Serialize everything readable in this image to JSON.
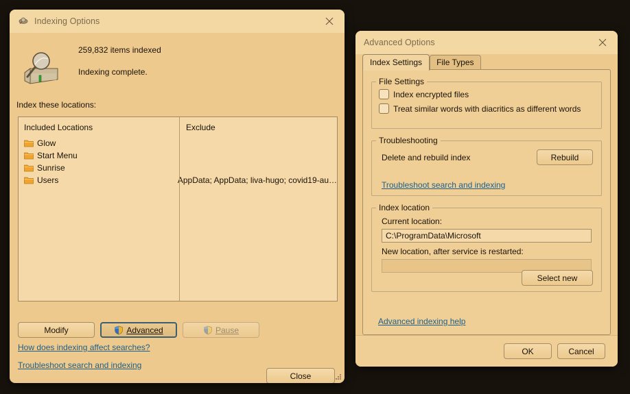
{
  "theme": {
    "desktop_bg": "#17120c",
    "window_bg": "#edc98e",
    "titlebar_bg": "#f4d8a4",
    "link_color": "#1c5f8a",
    "field_bg": "#f5d9a9",
    "border_color": "#a58e66"
  },
  "indexing_options": {
    "title": "Indexing Options",
    "title_icon": "indexing-options-icon",
    "close_icon": "close-icon",
    "status": {
      "icon": "hard-drive-search-icon",
      "count_text": "259,832 items indexed",
      "state_text": "Indexing complete."
    },
    "locations_label": "Index these locations:",
    "list": {
      "columns": [
        "Included Locations",
        "Exclude"
      ],
      "rows": [
        {
          "icon": "folder-icon",
          "name": "Glow",
          "exclude": ""
        },
        {
          "icon": "folder-icon",
          "name": "Start Menu",
          "exclude": ""
        },
        {
          "icon": "folder-icon",
          "name": "Sunrise",
          "exclude": ""
        },
        {
          "icon": "folder-icon",
          "name": "Users",
          "exclude": "AppData; AppData; liva-hugo; covid19-au…"
        }
      ]
    },
    "buttons": {
      "modify": "Modify",
      "modify_accesskey": "M",
      "advanced": "Advanced",
      "advanced_accesskey": "d",
      "advanced_icon": "uac-shield-icon",
      "advanced_focused": true,
      "pause": "Pause",
      "pause_accesskey": "P",
      "pause_icon": "uac-shield-icon",
      "pause_disabled": true,
      "close": "Close"
    },
    "links": {
      "how_does_indexing": "How does indexing affect searches?",
      "troubleshoot": "Troubleshoot search and indexing"
    },
    "resize_grip": "resize-grip-icon"
  },
  "advanced_options": {
    "title": "Advanced Options",
    "close_icon": "close-icon",
    "tabs": [
      {
        "label": "Index Settings",
        "active": true
      },
      {
        "label": "File Types",
        "active": false
      }
    ],
    "file_settings": {
      "legend": "File Settings",
      "checkboxes": [
        {
          "label": "Index encrypted files",
          "checked": false
        },
        {
          "label": "Treat similar words with diacritics as different words",
          "checked": false
        }
      ]
    },
    "troubleshooting": {
      "legend": "Troubleshooting",
      "rebuild_label": "Delete and rebuild index",
      "rebuild_button": "Rebuild",
      "link": "Troubleshoot search and indexing"
    },
    "index_location": {
      "legend": "Index location",
      "current_label": "Current location:",
      "current_value": "C:\\ProgramData\\Microsoft",
      "new_label": "New location, after service is restarted:",
      "new_value": "",
      "select_new_button": "Select new"
    },
    "help_link": "Advanced indexing help",
    "footer": {
      "ok": "OK",
      "cancel": "Cancel"
    }
  }
}
